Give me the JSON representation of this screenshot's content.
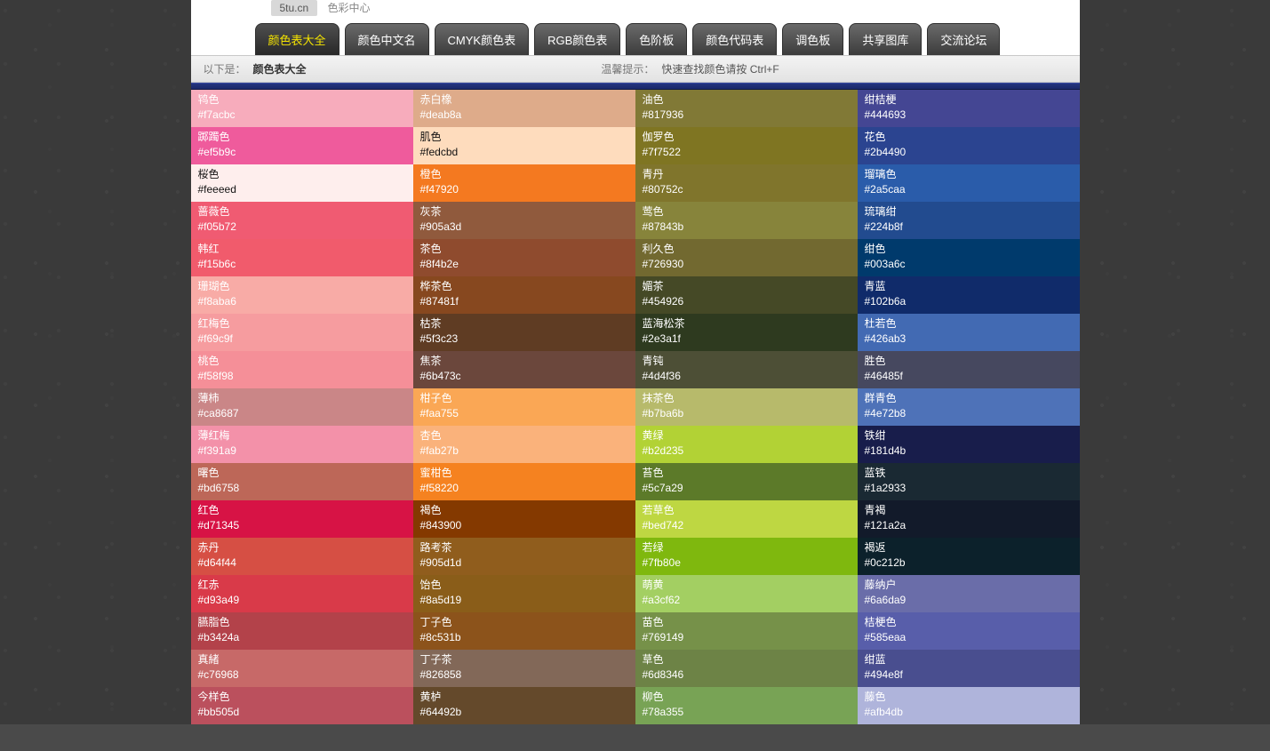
{
  "header": {
    "domain": "5tu.cn",
    "subtitle": "色彩中心"
  },
  "tabs": [
    {
      "label": "颜色表大全",
      "active": true
    },
    {
      "label": "颜色中文名"
    },
    {
      "label": "CMYK颜色表"
    },
    {
      "label": "RGB颜色表"
    },
    {
      "label": "色阶板"
    },
    {
      "label": "颜色代码表"
    },
    {
      "label": "调色板"
    },
    {
      "label": "共享图库"
    },
    {
      "label": "交流论坛"
    }
  ],
  "infobar": {
    "prefix": "以下是：",
    "title": "颜色表大全",
    "hint_label": "温馨提示：",
    "hint": "快速查找颜色请按 Ctrl+F"
  },
  "columns": [
    [
      {
        "name": "鸨色",
        "hex": "#f7acbc"
      },
      {
        "name": "踯躅色",
        "hex": "#ef5b9c"
      },
      {
        "name": "桜色",
        "hex": "#feeeed",
        "dark": true
      },
      {
        "name": "蔷薇色",
        "hex": "#f05b72"
      },
      {
        "name": "韩红",
        "hex": "#f15b6c"
      },
      {
        "name": "珊瑚色",
        "hex": "#f8aba6"
      },
      {
        "name": "红梅色",
        "hex": "#f69c9f"
      },
      {
        "name": "桃色",
        "hex": "#f58f98"
      },
      {
        "name": "薄柿",
        "hex": "#ca8687"
      },
      {
        "name": "薄红梅",
        "hex": "#f391a9"
      },
      {
        "name": "曙色",
        "hex": "#bd6758"
      },
      {
        "name": "红色",
        "hex": "#d71345"
      },
      {
        "name": "赤丹",
        "hex": "#d64f44"
      },
      {
        "name": "红赤",
        "hex": "#d93a49"
      },
      {
        "name": "臙脂色",
        "hex": "#b3424a"
      },
      {
        "name": "真緒",
        "hex": "#c76968"
      },
      {
        "name": "今样色",
        "hex": "#bb505d"
      }
    ],
    [
      {
        "name": "赤白橡",
        "hex": "#deab8a"
      },
      {
        "name": "肌色",
        "hex": "#fedcbd",
        "dark": true
      },
      {
        "name": "橙色",
        "hex": "#f47920"
      },
      {
        "name": "灰茶",
        "hex": "#905a3d"
      },
      {
        "name": "茶色",
        "hex": "#8f4b2e"
      },
      {
        "name": "桦茶色",
        "hex": "#87481f"
      },
      {
        "name": "枯茶",
        "hex": "#5f3c23"
      },
      {
        "name": "焦茶",
        "hex": "#6b473c"
      },
      {
        "name": "柑子色",
        "hex": "#faa755"
      },
      {
        "name": "杏色",
        "hex": "#fab27b"
      },
      {
        "name": "蜜柑色",
        "hex": "#f58220"
      },
      {
        "name": "褐色",
        "hex": "#843900"
      },
      {
        "name": "路考茶",
        "hex": "#905d1d"
      },
      {
        "name": "饴色",
        "hex": "#8a5d19"
      },
      {
        "name": "丁子色",
        "hex": "#8c531b"
      },
      {
        "name": "丁子茶",
        "hex": "#826858"
      },
      {
        "name": "黄栌",
        "hex": "#64492b"
      }
    ],
    [
      {
        "name": "油色",
        "hex": "#817936"
      },
      {
        "name": "伽罗色",
        "hex": "#7f7522"
      },
      {
        "name": "青丹",
        "hex": "#80752c"
      },
      {
        "name": "莺色",
        "hex": "#87843b"
      },
      {
        "name": "利久色",
        "hex": "#726930"
      },
      {
        "name": "媚茶",
        "hex": "#454926"
      },
      {
        "name": "蓝海松茶",
        "hex": "#2e3a1f"
      },
      {
        "name": "青钝",
        "hex": "#4d4f36"
      },
      {
        "name": "抹茶色",
        "hex": "#b7ba6b"
      },
      {
        "name": "黄绿",
        "hex": "#b2d235"
      },
      {
        "name": "苔色",
        "hex": "#5c7a29"
      },
      {
        "name": "若草色",
        "hex": "#bed742"
      },
      {
        "name": "若绿",
        "hex": "#7fb80e"
      },
      {
        "name": "萌黄",
        "hex": "#a3cf62"
      },
      {
        "name": "苗色",
        "hex": "#769149"
      },
      {
        "name": "草色",
        "hex": "#6d8346"
      },
      {
        "name": "柳色",
        "hex": "#78a355"
      }
    ],
    [
      {
        "name": "绀桔梗",
        "hex": "#444693"
      },
      {
        "name": "花色",
        "hex": "#2b4490"
      },
      {
        "name": "瑠璃色",
        "hex": "#2a5caa"
      },
      {
        "name": "琉璃绀",
        "hex": "#224b8f"
      },
      {
        "name": "绀色",
        "hex": "#003a6c"
      },
      {
        "name": "青蓝",
        "hex": "#102b6a"
      },
      {
        "name": "杜若色",
        "hex": "#426ab3"
      },
      {
        "name": "胜色",
        "hex": "#46485f"
      },
      {
        "name": "群青色",
        "hex": "#4e72b8"
      },
      {
        "name": "铁绀",
        "hex": "#181d4b"
      },
      {
        "name": "蓝铁",
        "hex": "#1a2933"
      },
      {
        "name": "青褐",
        "hex": "#121a2a"
      },
      {
        "name": "褐返",
        "hex": "#0c212b"
      },
      {
        "name": "藤纳户",
        "hex": "#6a6da9"
      },
      {
        "name": "桔梗色",
        "hex": "#585eaa"
      },
      {
        "name": "绀蓝",
        "hex": "#494e8f"
      },
      {
        "name": "藤色",
        "hex": "#afb4db"
      }
    ]
  ]
}
